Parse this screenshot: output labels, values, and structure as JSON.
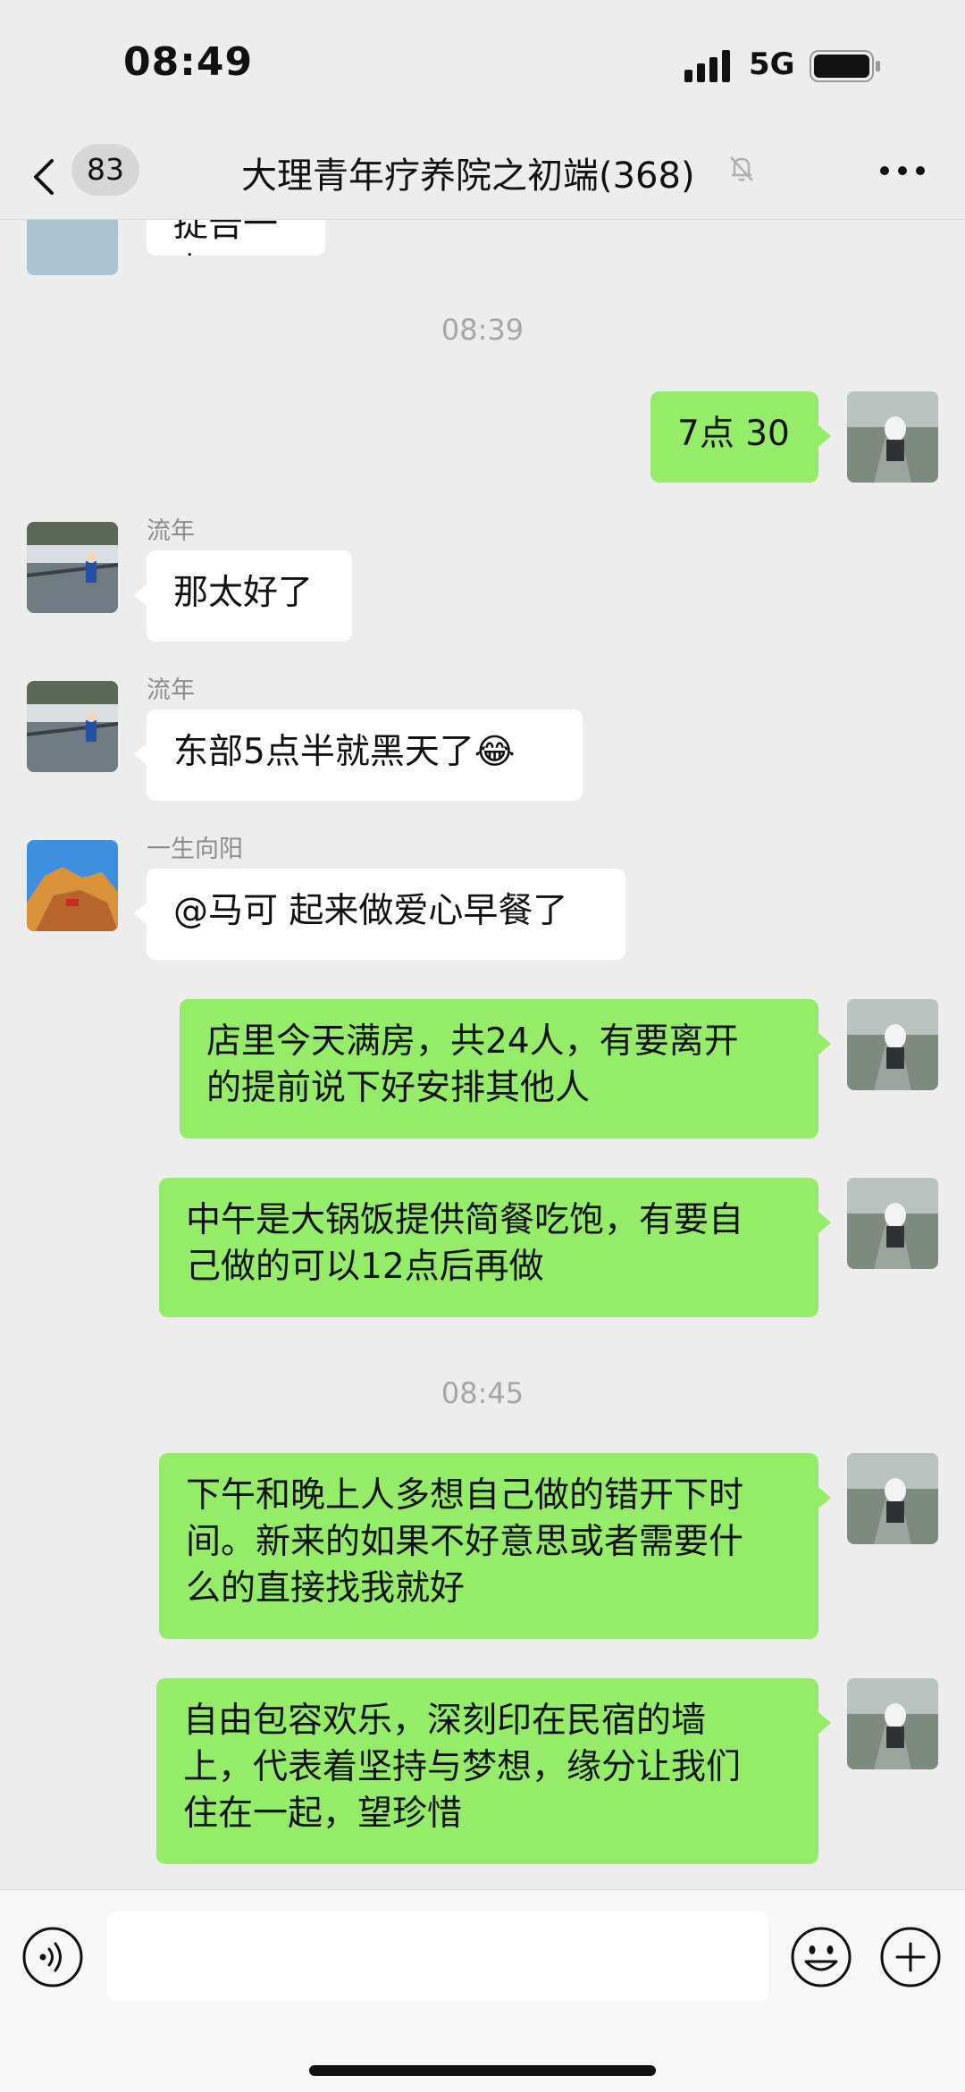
{
  "status": {
    "time": "08:49",
    "network": "5G"
  },
  "nav": {
    "unread_count": "83",
    "title": "大理青年疗养院之初端(368)"
  },
  "timestamps": [
    "08:39",
    "08:45"
  ],
  "messages": [
    {
      "text": "捉告一上"
    },
    {
      "text": "7点 30"
    },
    {
      "sender": "流年",
      "text": "那太好了"
    },
    {
      "sender": "流年",
      "text": "东部5点半就黑天了😂"
    },
    {
      "sender": "一生向阳",
      "text": "@马可 起来做爱心早餐了"
    },
    {
      "line1": "店里今天满房，共24人，有要离开",
      "line2": "的提前说下好安排其他人"
    },
    {
      "line1": "中午是大锅饭提供简餐吃饱，有要自",
      "line2": "己做的可以12点后再做"
    },
    {
      "line1": "下午和晚上人多想自己做的错开下时",
      "line2": "间。新来的如果不好意思或者需要什",
      "line3": "么的直接找我就好"
    },
    {
      "line1": "自由包容欢乐，深刻印在民宿的墙",
      "line2": "上，代表着坚持与梦想，缘分让我们",
      "line3": "住在一起，望珍惜"
    }
  ],
  "icons": {
    "back": "chevron-left-icon",
    "mute": "bell-off-icon",
    "more": "more-dots-icon",
    "voice": "voice-icon",
    "emoji": "smiley-icon",
    "plus": "plus-icon"
  },
  "colors": {
    "outgoing_bubble": "#95ec69",
    "incoming_bubble": "#ffffff",
    "background": "#ededed"
  },
  "input": {
    "value": ""
  }
}
